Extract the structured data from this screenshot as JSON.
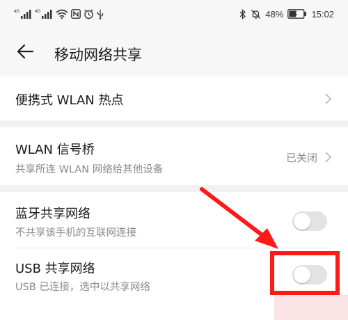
{
  "status_bar": {
    "left_icons": [
      "signal-4g-icon",
      "signal-4g-icon",
      "wifi-icon",
      "nfc-icon",
      "alarm-icon",
      "usb-icon"
    ],
    "signal_label": "4G",
    "right_icons": [
      "bluetooth-icon",
      "mute-icon",
      "battery-icon"
    ],
    "battery_percent": "48%",
    "battery_level": 0.48,
    "time": "15:02"
  },
  "header": {
    "title": "移动网络共享",
    "back_icon": "arrow-left-icon"
  },
  "settings": {
    "hotspot": {
      "title": "便携式 WLAN 热点"
    },
    "bridge": {
      "title": "WLAN 信号桥",
      "subtitle": "共享所连 WLAN 网络给其他设备",
      "value": "已关闭"
    },
    "bluetooth": {
      "title": "蓝牙共享网络",
      "subtitle": "不共享该手机的互联网连接",
      "enabled": false
    },
    "usb": {
      "title": "USB 共享网络",
      "subtitle": "USB 已连接，选中以共享网络",
      "enabled": false
    }
  },
  "annotation": {
    "color": "#ff1a1a"
  },
  "colors": {
    "background": "#f2f2f2",
    "card": "#ffffff",
    "switch_off": "#e3e3e3",
    "subtitle": "#8a8a8a"
  }
}
